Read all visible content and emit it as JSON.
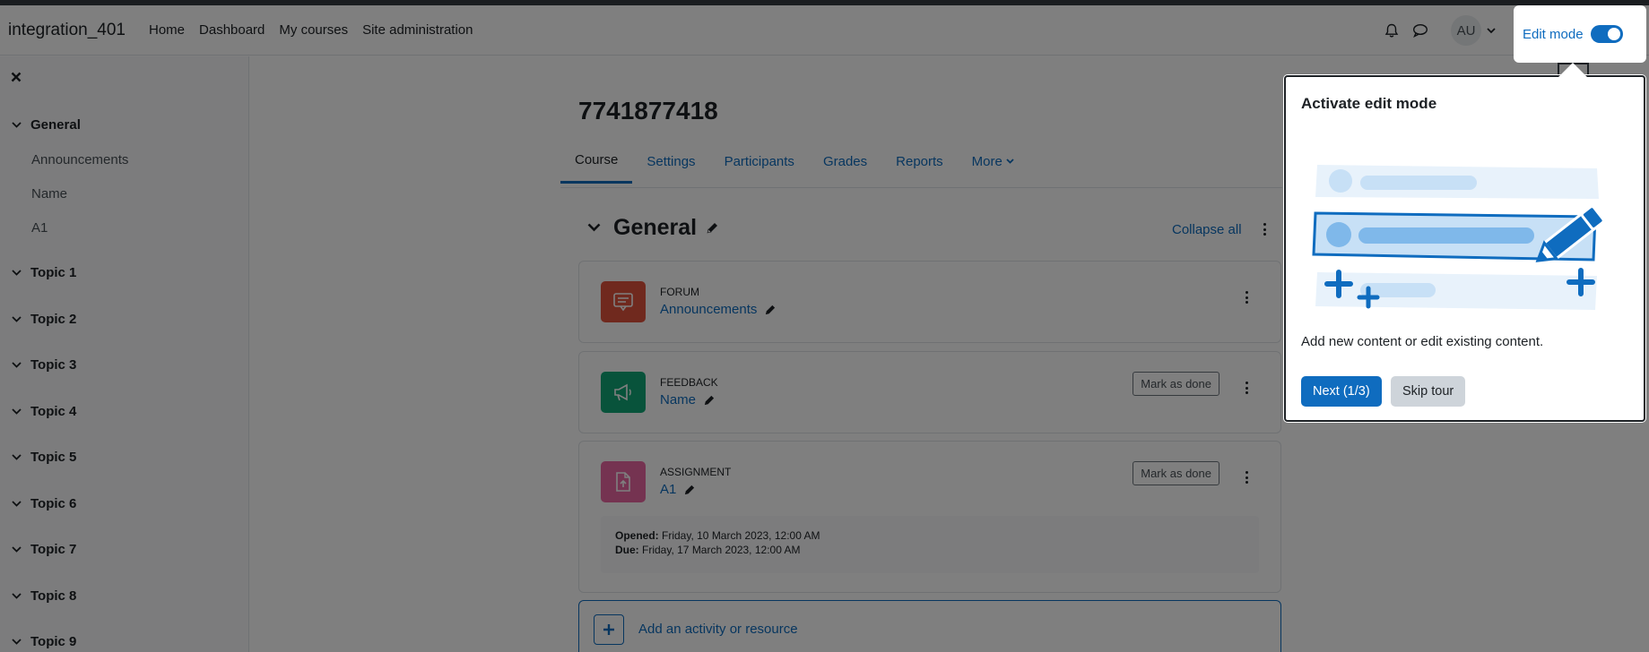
{
  "navbar": {
    "brand": "integration_401",
    "links": [
      "Home",
      "Dashboard",
      "My courses",
      "Site administration"
    ],
    "avatar_initials": "AU",
    "edit_mode_label": "Edit mode",
    "icons": [
      "bell-icon",
      "chat-icon",
      "chevron-down-icon"
    ]
  },
  "drawer": {
    "close_icon": "close-icon",
    "sections": [
      {
        "label": "General",
        "items": [
          "Announcements",
          "Name",
          "A1"
        ]
      },
      {
        "label": "Topic 1"
      },
      {
        "label": "Topic 2"
      },
      {
        "label": "Topic 3"
      },
      {
        "label": "Topic 4"
      },
      {
        "label": "Topic 5"
      },
      {
        "label": "Topic 6"
      },
      {
        "label": "Topic 7"
      },
      {
        "label": "Topic 8"
      },
      {
        "label": "Topic 9"
      }
    ]
  },
  "course": {
    "title": "7741877418",
    "tabs": [
      "Course",
      "Settings",
      "Participants",
      "Grades",
      "Reports",
      "More"
    ],
    "active_tab": "Course",
    "section_title": "General",
    "collapse_all": "Collapse all",
    "activities": [
      {
        "type": "Forum",
        "name": "Announcements",
        "color": "#e1523d",
        "icon": "forum-icon"
      },
      {
        "type": "Feedback",
        "name": "Name",
        "color": "#11a676",
        "icon": "megaphone-icon",
        "mark_done": "Mark as done"
      },
      {
        "type": "Assignment",
        "name": "A1",
        "color": "#eb66a2",
        "icon": "assignment-upload-icon",
        "mark_done": "Mark as done",
        "opened_label": "Opened:",
        "opened": "Friday, 10 March 2023, 12:00 AM",
        "due_label": "Due:",
        "due": "Friday, 17 March 2023, 12:00 AM"
      }
    ],
    "add_activity": "Add an activity or resource"
  },
  "tour": {
    "title": "Activate edit mode",
    "text": "Add new content or edit existing content.",
    "next_label": "Next (1/3)",
    "skip_label": "Skip tour"
  },
  "colors": {
    "accent": "#0f6cbf",
    "backdrop": "rgba(0,0,0,0.5)"
  }
}
